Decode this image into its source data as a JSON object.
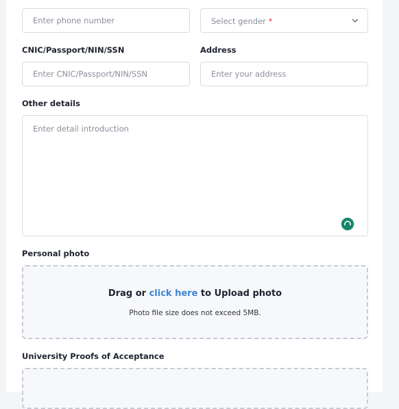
{
  "fields": {
    "phone": {
      "placeholder": "Enter phone number"
    },
    "gender": {
      "placeholder": "Select gender",
      "required_mark": "*"
    },
    "id_doc": {
      "label": "CNIC/Passport/NIN/SSN",
      "placeholder": "Enter CNIC/Passport/NIN/SSN"
    },
    "address": {
      "label": "Address",
      "placeholder": "Enter your address"
    },
    "other": {
      "label": "Other details",
      "placeholder": "Enter detail introduction"
    }
  },
  "photo": {
    "label": "Personal photo",
    "drag": "Drag or",
    "link": "click here",
    "suffix": "to Upload photo",
    "hint": "Photo file size does not exceed 5MB."
  },
  "proofs": {
    "label": "University Proofs of Acceptance"
  },
  "icons": {
    "chevron": "chevron-down-icon",
    "grammarly": "grammarly-icon"
  },
  "colors": {
    "link": "#3a86d4",
    "required": "#e53935",
    "grammarly": "#15846a"
  }
}
